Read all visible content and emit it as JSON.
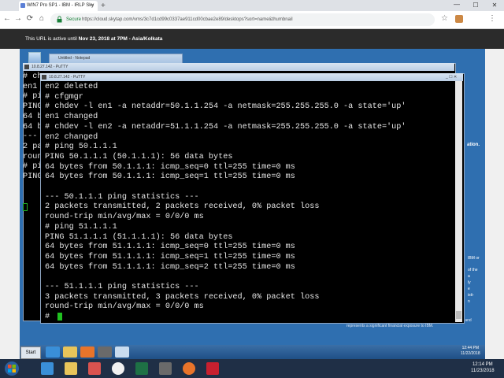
{
  "browser": {
    "tab_title": "WIN7 Pro SP1 - IBM - IRLP Sky",
    "tab_close": "×",
    "new_tab": "+",
    "window_controls": {
      "minimize": "—",
      "maximize": "☐",
      "close": "✕"
    },
    "nav": {
      "back": "←",
      "forward": "→",
      "reload": "⟳",
      "home": "⌂"
    },
    "secure_label": "Secure",
    "url": "https://cloud.skytap.com/vms/3c7d1cd99c0337ae911cd00cbae2e89/desktops?sort=name&thumbnail",
    "star": "☆",
    "menu": "⋮"
  },
  "banner": {
    "prefix": "This URL is active until ",
    "date": "Nov 23, 2018 at 7PM - Asia/Kolkata"
  },
  "remote": {
    "notepad_title": "Untitled - Notepad",
    "putty_back_title": "10.8.27.142 - PuTTY",
    "putty_front_title": "10.8.27.142 - PuTTY",
    "putty_controls": "_ ☐ ✕",
    "side_heading": "ation.",
    "side_lines": [
      "IBM or",
      "of the",
      "a",
      "ly",
      "e",
      "isti-",
      "n"
    ],
    "footer_text": "ment procedures is a violation of IBM Business Conduct Guidelines and represents a significant financial exposure to IBM.",
    "start_label": "Start",
    "clock_time": "12:44 PM",
    "clock_date": "11/22/2018"
  },
  "terminal_back": [
    "# ch",
    "en1 ",
    "# pi",
    "PING",
    "64 b",
    "64 b",
    "---",
    "2 pa",
    "roun",
    "# pi",
    "PING"
  ],
  "terminal_front": [
    "en2 deleted",
    "# cfgmgr",
    "# chdev -l en1 -a netaddr=50.1.1.254 -a netmask=255.255.255.0 -a state='up'",
    "en1 changed",
    "# chdev -l en2 -a netaddr=51.1.1.254 -a netmask=255.255.255.0 -a state='up'",
    "en2 changed",
    "# ping 50.1.1.1",
    "PING 50.1.1.1 (50.1.1.1): 56 data bytes",
    "64 bytes from 50.1.1.1: icmp_seq=0 ttl=255 time=0 ms",
    "64 bytes from 50.1.1.1: icmp_seq=1 ttl=255 time=0 ms",
    "",
    "--- 50.1.1.1 ping statistics ---",
    "2 packets transmitted, 2 packets received, 0% packet loss",
    "round-trip min/avg/max = 0/0/0 ms",
    "# ping 51.1.1.1",
    "PING 51.1.1.1 (51.1.1.1): 56 data bytes",
    "64 bytes from 51.1.1.1: icmp_seq=0 ttl=255 time=0 ms",
    "64 bytes from 51.1.1.1: icmp_seq=1 ttl=255 time=0 ms",
    "64 bytes from 51.1.1.1: icmp_seq=2 ttl=255 time=0 ms",
    "",
    "--- 51.1.1.1 ping statistics ---",
    "3 packets transmitted, 3 packets received, 0% packet loss",
    "round-trip min/avg/max = 0/0/0 ms",
    "# "
  ],
  "host_taskbar": {
    "clock_time": "12:14 PM",
    "clock_date": "11/23/2018"
  }
}
